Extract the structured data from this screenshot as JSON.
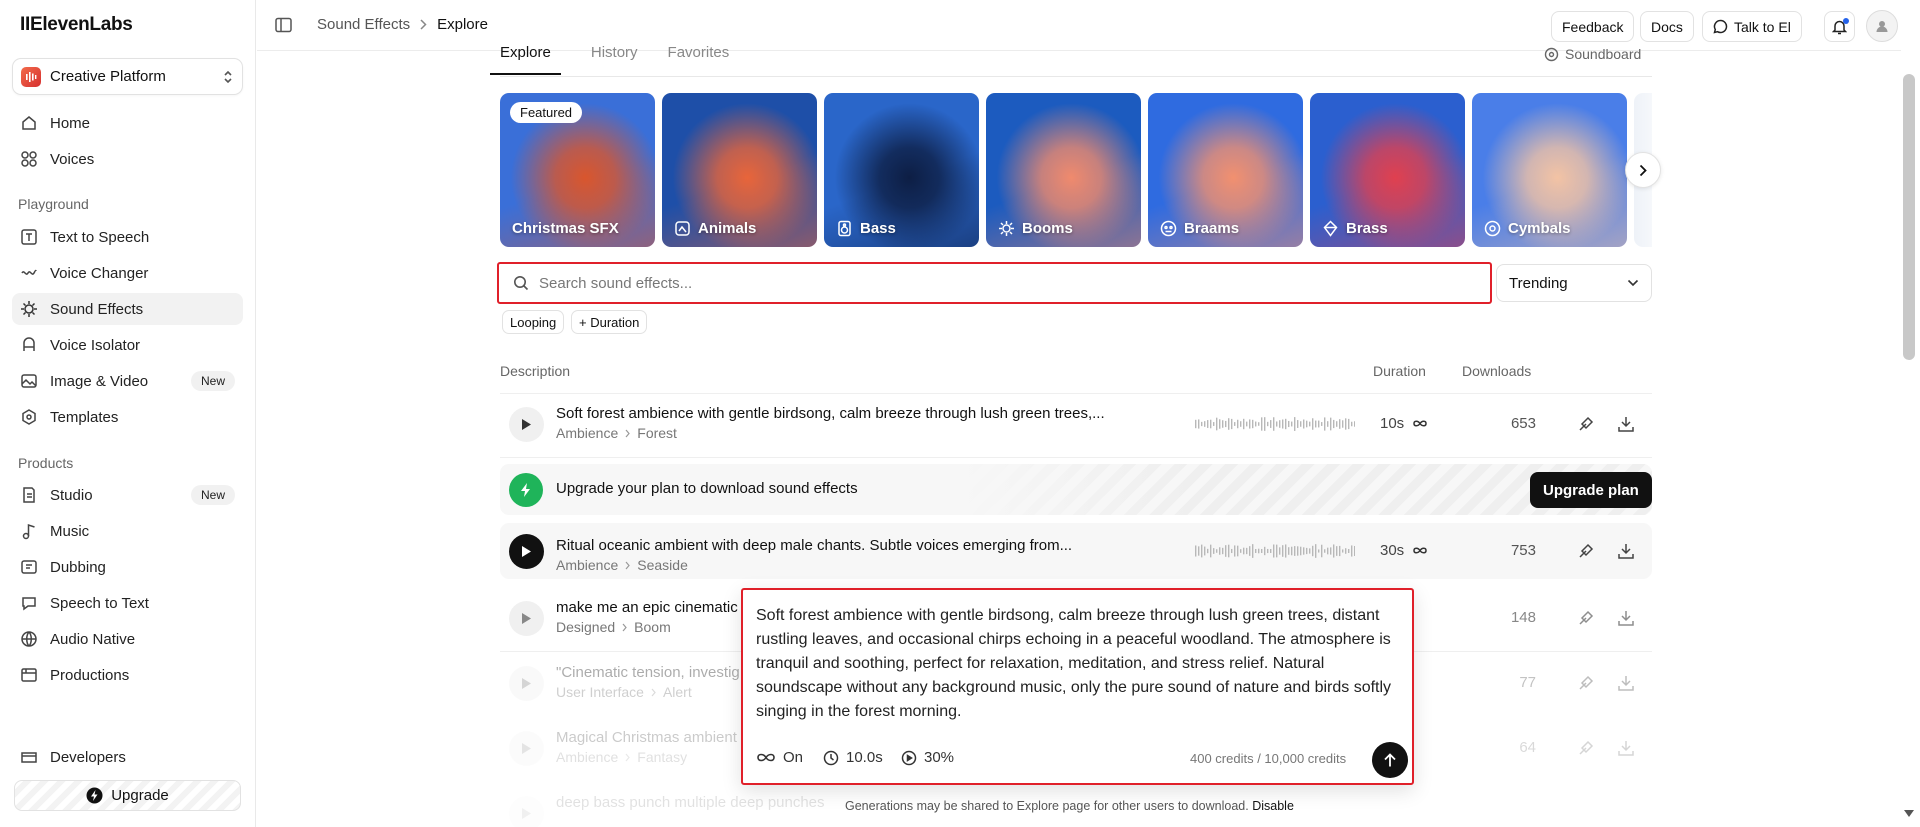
{
  "sidebar": {
    "logo": "IIElevenLabs",
    "workspace": "Creative Platform",
    "nav_top": [
      {
        "label": "Home",
        "icon": "home-icon"
      },
      {
        "label": "Voices",
        "icon": "voices-icon"
      }
    ],
    "section_playground": "Playground",
    "playground": [
      {
        "label": "Text to Speech",
        "icon": "text-to-speech-icon"
      },
      {
        "label": "Voice Changer",
        "icon": "voice-changer-icon"
      },
      {
        "label": "Sound Effects",
        "icon": "sound-effects-icon",
        "active": true
      },
      {
        "label": "Voice Isolator",
        "icon": "voice-isolator-icon"
      },
      {
        "label": "Image & Video",
        "icon": "image-video-icon",
        "badge": "New"
      },
      {
        "label": "Templates",
        "icon": "templates-icon"
      }
    ],
    "section_products": "Products",
    "products": [
      {
        "label": "Studio",
        "icon": "studio-icon",
        "badge": "New"
      },
      {
        "label": "Music",
        "icon": "music-icon"
      },
      {
        "label": "Dubbing",
        "icon": "dubbing-icon"
      },
      {
        "label": "Speech to Text",
        "icon": "speech-to-text-icon"
      },
      {
        "label": "Audio Native",
        "icon": "audio-native-icon"
      },
      {
        "label": "Productions",
        "icon": "productions-icon"
      }
    ],
    "developers": "Developers",
    "upgrade": "Upgrade"
  },
  "topbar": {
    "breadcrumb_parent": "Sound Effects",
    "breadcrumb_current": "Explore",
    "feedback": "Feedback",
    "docs": "Docs",
    "talk": "Talk to El"
  },
  "tabs": [
    "Explore",
    "History",
    "Favorites"
  ],
  "soundboard": "Soundboard",
  "featured_badge": "Featured",
  "categories": [
    {
      "label": "Christmas SFX",
      "icon": "",
      "colors": [
        "#3a6fd8",
        "#d9562d"
      ]
    },
    {
      "label": "Animals",
      "icon": "animals-icon",
      "colors": [
        "#1e4fa8",
        "#e8653a"
      ]
    },
    {
      "label": "Bass",
      "icon": "bass-icon",
      "colors": [
        "#2a66c9",
        "#0d1e44"
      ]
    },
    {
      "label": "Booms",
      "icon": "booms-icon",
      "colors": [
        "#1c5bbf",
        "#f08a6d"
      ]
    },
    {
      "label": "Braams",
      "icon": "braams-icon",
      "colors": [
        "#2f6be0",
        "#f2906f"
      ]
    },
    {
      "label": "Brass",
      "icon": "brass-icon",
      "colors": [
        "#2b5fcf",
        "#e0404f"
      ]
    },
    {
      "label": "Cymbals",
      "icon": "cymbals-icon",
      "colors": [
        "#4a7ee8",
        "#f3c3a4"
      ]
    }
  ],
  "search": {
    "placeholder": "Search sound effects...",
    "sort": "Trending"
  },
  "filters": {
    "looping": "Looping",
    "duration": "+ Duration"
  },
  "table": {
    "col_description": "Description",
    "col_duration": "Duration",
    "col_downloads": "Downloads",
    "rows": [
      {
        "title": "Soft forest ambience with gentle birdsong, calm breeze through lush green trees,...",
        "category": "Ambience",
        "subcategory": "Forest",
        "duration": "10s",
        "downloads": "653"
      },
      {
        "title": "Ritual oceanic ambient with deep male chants. Subtle voices emerging from...",
        "category": "Ambience",
        "subcategory": "Seaside",
        "duration": "30s",
        "downloads": "753"
      },
      {
        "title": "make me an epic cinematic",
        "category": "Designed",
        "subcategory": "Boom",
        "duration": "",
        "downloads": "148"
      },
      {
        "title": "\"Cinematic tension, investig",
        "category": "User Interface",
        "subcategory": "Alert",
        "duration": "",
        "downloads": "77"
      },
      {
        "title": "Magical Christmas ambient",
        "category": "Ambience",
        "subcategory": "Fantasy",
        "duration": "",
        "downloads": "64"
      },
      {
        "title": "deep bass punch multiple deep punches",
        "category": "",
        "subcategory": "",
        "duration": "",
        "downloads": ""
      }
    ]
  },
  "upgrade_banner": {
    "text": "Upgrade your plan to download sound effects",
    "button": "Upgrade plan"
  },
  "prompt": {
    "text": "Soft forest ambience with gentle birdsong, calm breeze through lush green trees, distant rustling leaves, and occasional chirps echoing in a peaceful woodland. The atmosphere is tranquil and soothing, perfect for relaxation, meditation, and stress relief. Natural soundscape without any background music, only the pure sound of nature and birds softly singing in the forest morning.",
    "loop": "On",
    "duration": "10.0s",
    "influence": "30%",
    "credits": "400 credits / 10,000 credits"
  },
  "notice": {
    "text": "Generations may be shared to Explore page for other users to download.",
    "link": "Disable"
  }
}
